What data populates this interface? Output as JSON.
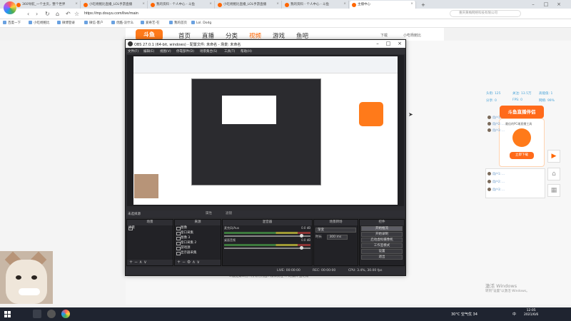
{
  "browser": {
    "tabs": [
      {
        "title": "360导航_一个主页，整个世界"
      },
      {
        "title": "小吃杨鲍比直播_LOL手游直播"
      },
      {
        "title": "我的资料 - 个人中心 - 斗鱼"
      },
      {
        "title": "小吃杨鲍比直播_LOL手游直播"
      },
      {
        "title": "我的资料 - 个人中心 - 斗鱼"
      },
      {
        "title": "主播中心"
      }
    ],
    "new_tab": "+",
    "url": "https://mp.douyu.com/live/main",
    "search_placeholder": "重庆黄桷网络科技有限公司",
    "bookmarks": [
      "百度一下",
      "小吃杨鲍比",
      "微博登录",
      "微信-客户",
      "优酷-没什么",
      "爱奇艺-在",
      "我的首页",
      "Lol. Dodg"
    ]
  },
  "douyu": {
    "logo": "斗鱼",
    "nav": [
      "首页",
      "直播",
      "分类",
      "视频",
      "游戏",
      "鱼吧"
    ],
    "nav_active": "视频",
    "download": "下载",
    "user": "小吃杨鲍比"
  },
  "obs": {
    "title": "OBS 27.0.1 (64-bit, windows) - 配置文件: 未命名 - 场景: 未命名",
    "menu": [
      "文件(F)",
      "编辑(E)",
      "视图(V)",
      "停靠部件(D)",
      "场景集合(S)",
      "工具(T)",
      "帮助(H)"
    ],
    "no_source": "未选择源",
    "props_btn": "属性",
    "filters_btn": "滤镜",
    "docks": {
      "scenes": {
        "title": "场景",
        "items": [
          "场景"
        ]
      },
      "sources": {
        "title": "来源",
        "items": [
          "图像",
          "窗口采集",
          "图像 3",
          "窗口采集 2",
          "游戏源",
          "显示器采集"
        ]
      },
      "mixer": {
        "title": "混音器",
        "channels": [
          {
            "name": "麦克风/Aux",
            "db": "0.0 dB"
          },
          {
            "name": "桌面音频",
            "db": "0.0 dB"
          }
        ]
      },
      "transitions": {
        "title": "场景转场",
        "type": "渐变",
        "duration_label": "时长",
        "duration": "300 ms"
      },
      "controls": {
        "title": "控件",
        "buttons": [
          "开始推流",
          "开始录制",
          "启动虚拟摄像机",
          "工作室模式",
          "设置",
          "退出"
        ]
      }
    },
    "status": {
      "live": "LIVE: 00:00:00",
      "rec": "REC: 00:00:00",
      "cpu": "CPU: 3.4%, 30.00 fps"
    }
  },
  "page": {
    "side_text_1": "6.触犯主播可...",
    "bottom_text": "4.触犯第三方...所有行为由...法律责任 ... 的加入 鱼吧帐"
  },
  "right_panel": {
    "stats": [
      "头衔: 125",
      "关注: 13.5万",
      "高能值: 1",
      "分享: 0",
      "FPS: 0",
      "网络: 99%"
    ],
    "promo_title": "斗鱼直播伴侣",
    "promo_sub": "最佳的PC端直播工具",
    "promo_btn": "立即下载",
    "chat": [
      "用户1: ...",
      "用户2: ...",
      "用户3: ..."
    ],
    "activate_title": "激活 Windows",
    "activate_sub": "转到\"设置\"以激活 Windows。"
  },
  "taskbar": {
    "weather": "30°C 空气优 34",
    "ime": "中",
    "time": "12:05",
    "date": "2021/6/6"
  }
}
